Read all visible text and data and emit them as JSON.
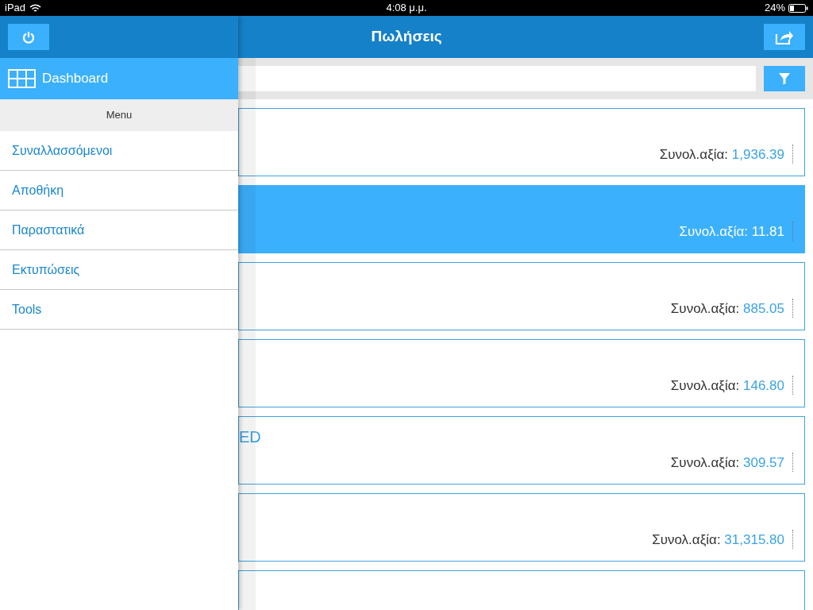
{
  "status_bar": {
    "device": "iPad",
    "time": "4:08 μ.μ.",
    "battery": "24%"
  },
  "header": {
    "title": "Πωλήσεις"
  },
  "cards": [
    {
      "total_label": "Συνολ.αξία:",
      "total": "1,936.39",
      "selected": false
    },
    {
      "total_label": "Συνολ.αξία:",
      "total": "11.81",
      "selected": true
    },
    {
      "total_label": "Συνολ.αξία:",
      "total": "885.05",
      "selected": false
    },
    {
      "total_label": "Συνολ.αξία:",
      "total": "146.80",
      "selected": false
    },
    {
      "title": "ED",
      "total_label": "Συνολ.αξία:",
      "total": "309.57",
      "selected": false
    },
    {
      "total_label": "Συνολ.αξία:",
      "total": "31,315.80",
      "selected": false
    },
    {
      "selected": false
    }
  ],
  "drawer": {
    "dashboard": "Dashboard",
    "menu_header": "Menu",
    "items": [
      {
        "label": "Συναλλασσόμενοι"
      },
      {
        "label": "Αποθήκη"
      },
      {
        "label": "Παραστατικά"
      },
      {
        "label": "Εκτυπώσεις"
      },
      {
        "label": "Tools"
      }
    ]
  }
}
